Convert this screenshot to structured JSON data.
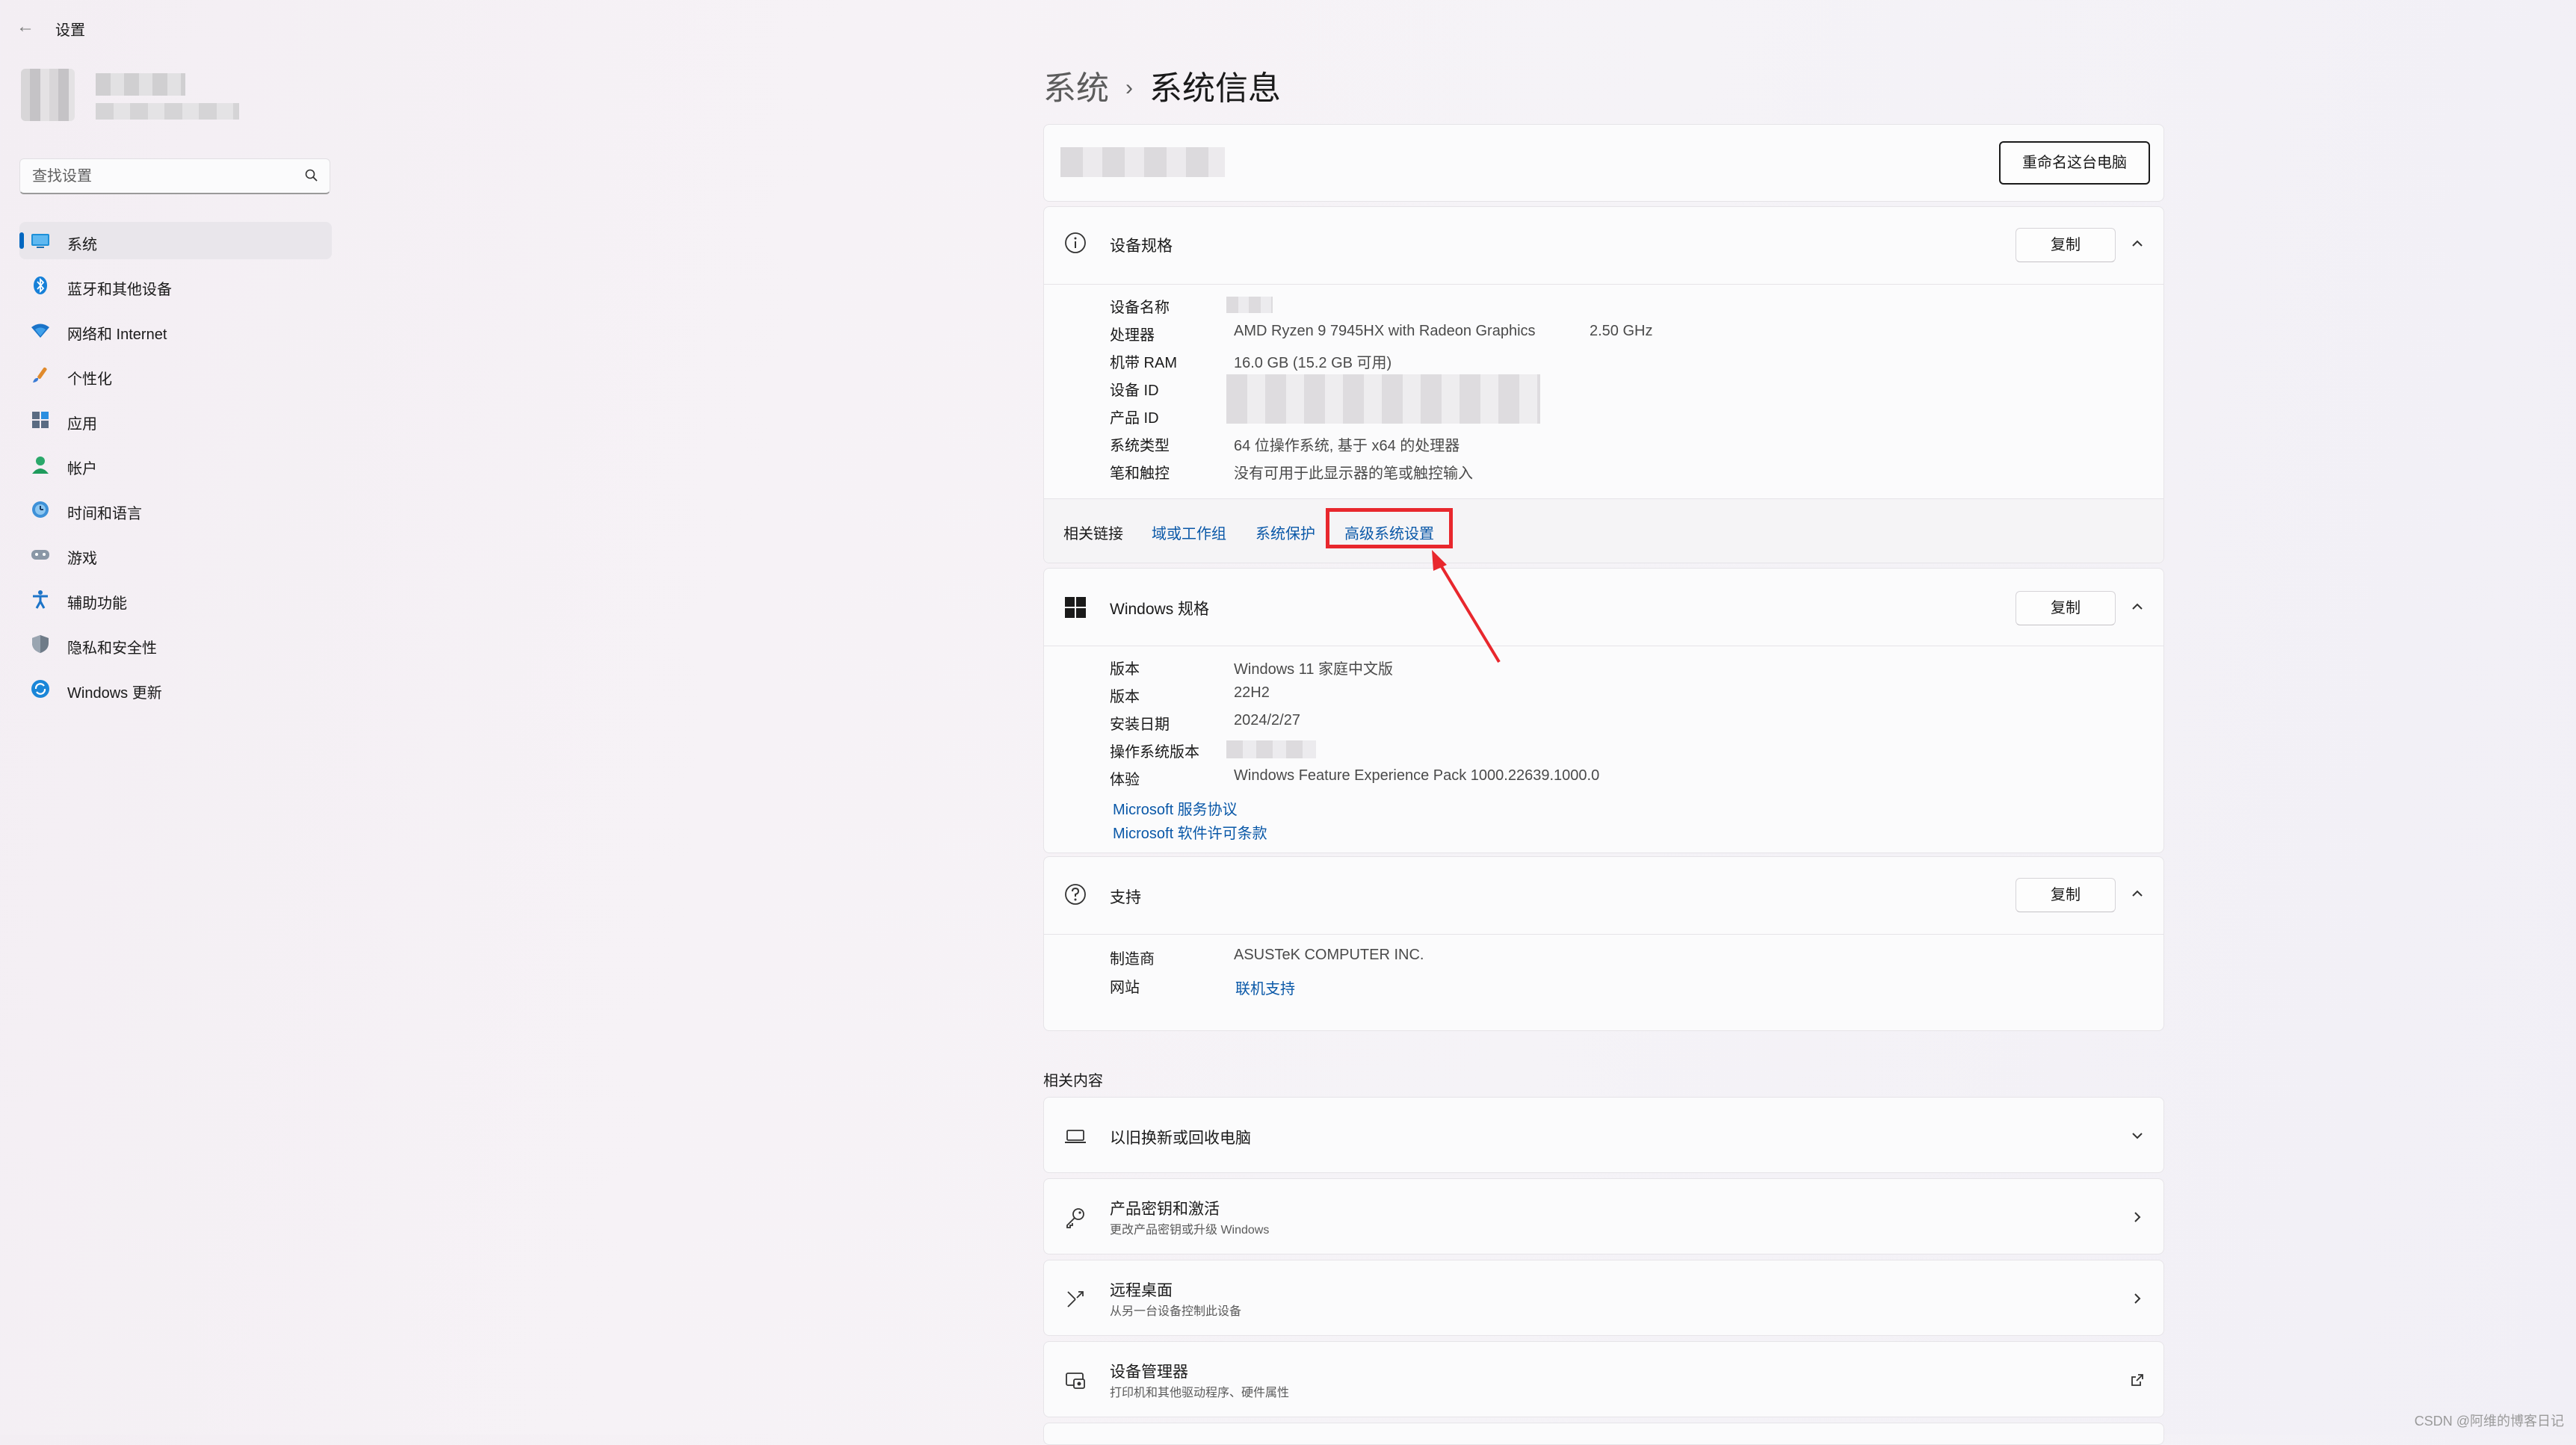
{
  "app": {
    "title": "设置"
  },
  "search": {
    "placeholder": "查找设置"
  },
  "nav": {
    "items": [
      {
        "label": "系统",
        "icon": "monitor-icon"
      },
      {
        "label": "蓝牙和其他设备",
        "icon": "bluetooth-icon"
      },
      {
        "label": "网络和 Internet",
        "icon": "wifi-icon"
      },
      {
        "label": "个性化",
        "icon": "brush-icon"
      },
      {
        "label": "应用",
        "icon": "apps-icon"
      },
      {
        "label": "帐户",
        "icon": "account-icon"
      },
      {
        "label": "时间和语言",
        "icon": "globe-clock-icon"
      },
      {
        "label": "游戏",
        "icon": "gamepad-icon"
      },
      {
        "label": "辅助功能",
        "icon": "accessibility-icon"
      },
      {
        "label": "隐私和安全性",
        "icon": "shield-icon"
      },
      {
        "label": "Windows 更新",
        "icon": "update-icon"
      }
    ]
  },
  "breadcrumb": {
    "parent": "系统",
    "separator": "›",
    "current": "系统信息"
  },
  "rename_button": "重命名这台电脑",
  "device_specs": {
    "title": "设备规格",
    "copy": "复制",
    "rows": [
      {
        "key": "设备名称",
        "value": ""
      },
      {
        "key": "处理器",
        "value": "AMD Ryzen 9 7945HX with Radeon Graphics",
        "extra": "2.50 GHz"
      },
      {
        "key": "机带 RAM",
        "value": "16.0 GB (15.2 GB 可用)"
      },
      {
        "key": "设备 ID",
        "value": ""
      },
      {
        "key": "产品 ID",
        "value": ""
      },
      {
        "key": "系统类型",
        "value": "64 位操作系统, 基于 x64 的处理器"
      },
      {
        "key": "笔和触控",
        "value": "没有可用于此显示器的笔或触控输入"
      }
    ]
  },
  "related_links": {
    "label": "相关链接",
    "links": [
      "域或工作组",
      "系统保护",
      "高级系统设置"
    ]
  },
  "windows_specs": {
    "title": "Windows 规格",
    "copy": "复制",
    "rows": [
      {
        "key": "版本",
        "value": "Windows 11 家庭中文版"
      },
      {
        "key": "版本",
        "value": "22H2"
      },
      {
        "key": "安装日期",
        "value": "2024/2/27"
      },
      {
        "key": "操作系统版本",
        "value": ""
      },
      {
        "key": "体验",
        "value": "Windows Feature Experience Pack 1000.22639.1000.0"
      }
    ],
    "links": [
      "Microsoft 服务协议",
      "Microsoft 软件许可条款"
    ]
  },
  "support": {
    "title": "支持",
    "copy": "复制",
    "rows": [
      {
        "key": "制造商",
        "value": "ASUSTeK COMPUTER INC."
      },
      {
        "key": "网站",
        "value": "联机支持"
      }
    ]
  },
  "related_content": {
    "heading": "相关内容",
    "items": [
      {
        "title": "以旧换新或回收电脑",
        "subtitle": ""
      },
      {
        "title": "产品密钥和激活",
        "subtitle": "更改产品密钥或升级 Windows"
      },
      {
        "title": "远程桌面",
        "subtitle": "从另一台设备控制此设备"
      },
      {
        "title": "设备管理器",
        "subtitle": "打印机和其他驱动程序、硬件属性"
      }
    ]
  },
  "watermark": "CSDN @阿维的博客日记",
  "colors": {
    "accent": "#0067c0",
    "link": "#0a58a8",
    "highlight": "#e8272d"
  }
}
